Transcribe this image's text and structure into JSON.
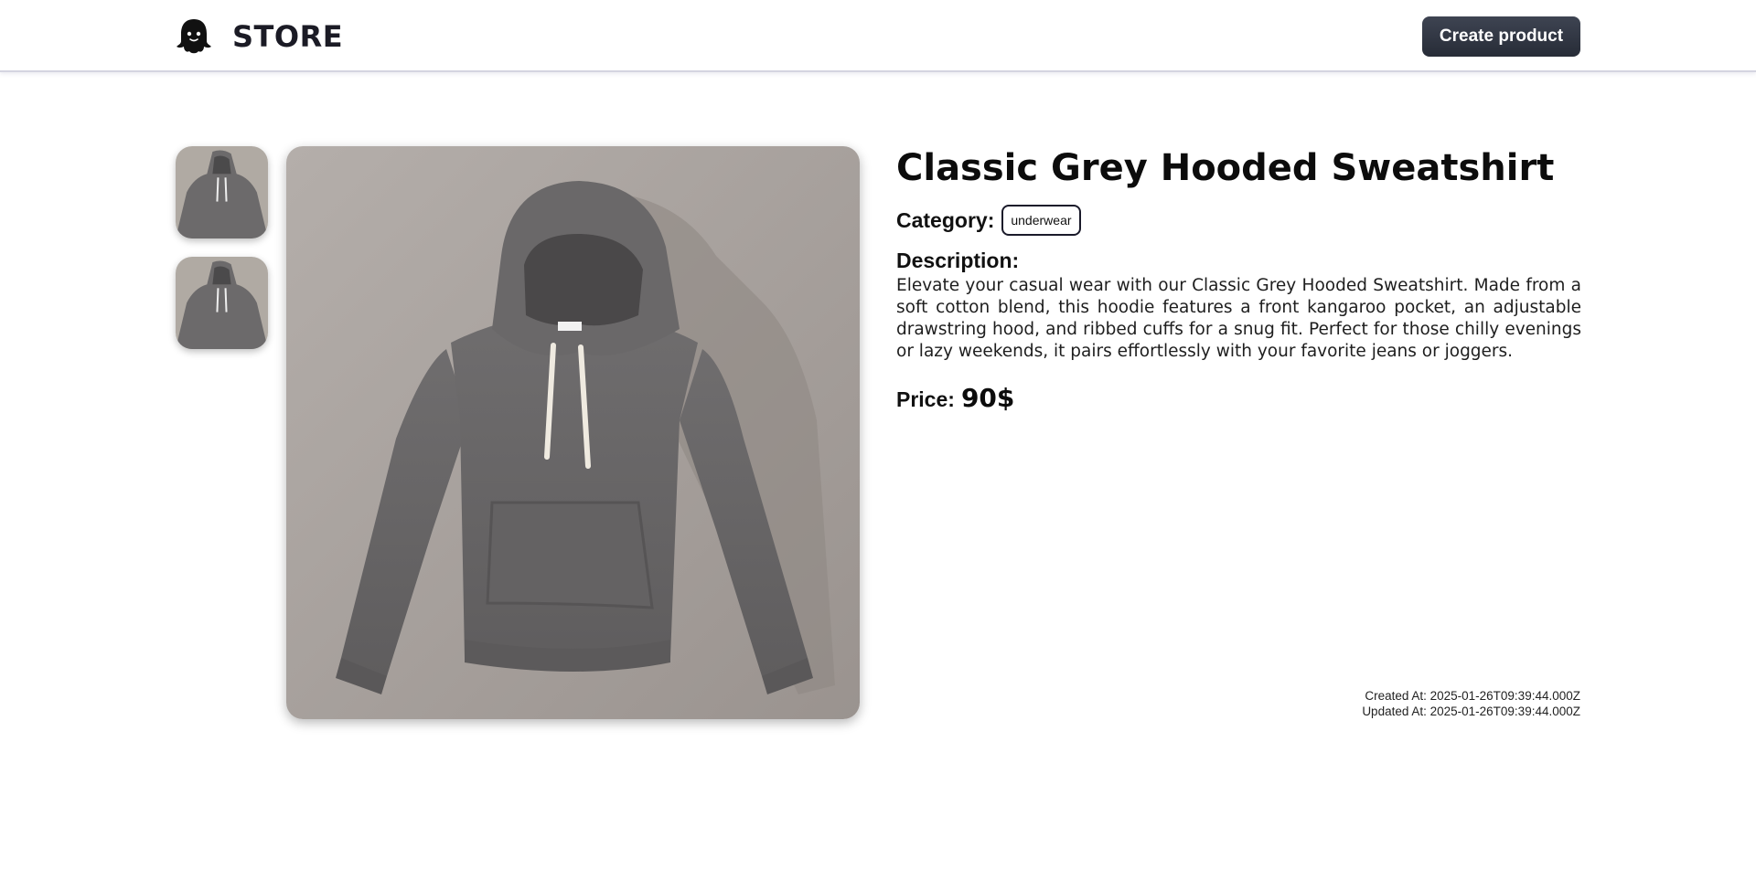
{
  "header": {
    "brand": "STORE",
    "logo_icon": "ghost-icon",
    "create_button_label": "Create product"
  },
  "gallery": {
    "thumbnails": [
      {
        "alt": "Classic Grey Hooded Sweatshirt"
      },
      {
        "alt": "Classic Grey Hooded Sweatshirt"
      }
    ],
    "main_alt": "Classic Grey Hooded Sweatshirt"
  },
  "product": {
    "title": "Classic Grey Hooded Sweatshirt",
    "category_label": "Category:",
    "category": "underwear",
    "description_label": "Description:",
    "description": "Elevate your casual wear with our Classic Grey Hooded Sweatshirt. Made from a soft cotton blend, this hoodie features a front kangaroo pocket, an adjustable drawstring hood, and ribbed cuffs for a snug fit. Perfect for those chilly evenings or lazy weekends, it pairs effortlessly with your favorite jeans or joggers.",
    "price_label": "Price:",
    "price": "90$",
    "created_at": "Created At: 2025-01-26T09:39:44.000Z",
    "updated_at": "Updated At: 2025-01-26T09:39:44.000Z"
  },
  "colors": {
    "button_bg": "#2f3441",
    "header_border": "#d4d4e0",
    "photo_bg": "#a49e9b",
    "hoodie": "#6b696a"
  }
}
